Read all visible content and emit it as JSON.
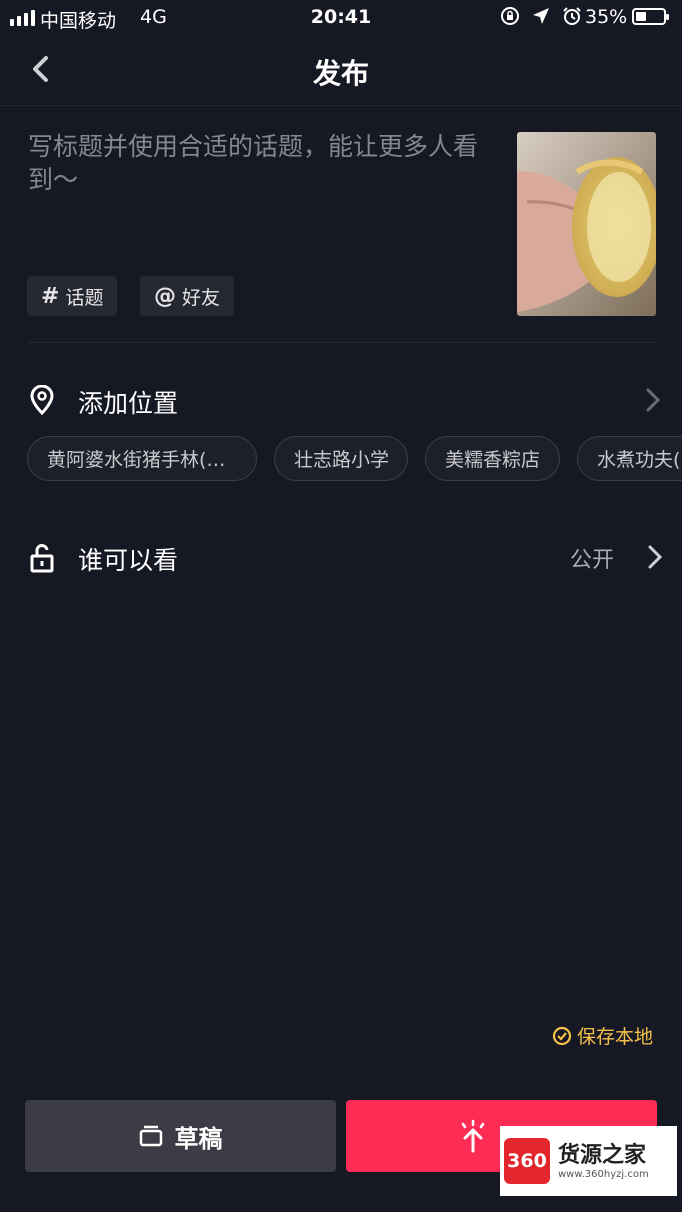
{
  "status_bar": {
    "carrier": "中国移动",
    "network": "4G",
    "time": "20:41",
    "battery": "35%"
  },
  "nav": {
    "title": "发布"
  },
  "caption": {
    "placeholder": "写标题并使用合适的话题，能让更多人看到～"
  },
  "chips": {
    "topic": {
      "symbol": "#",
      "label": "话题"
    },
    "friend": {
      "symbol": "@",
      "label": "好友"
    }
  },
  "location": {
    "label": "添加位置",
    "suggestions": [
      "黄阿婆水街猪手林(…",
      "壮志路小学",
      "美糯香粽店",
      "水煮功夫("
    ]
  },
  "privacy": {
    "label": "谁可以看",
    "value": "公开"
  },
  "save_local": {
    "label": "保存本地"
  },
  "buttons": {
    "draft": "草稿"
  },
  "watermark": {
    "logo": "360",
    "name": "货源之家",
    "url": "www.360hyzj.com"
  },
  "colors": {
    "background": "#161823",
    "accent": "#fe2c55",
    "save_local": "#f5c04a"
  },
  "icons": {
    "back": "chevron-left-icon",
    "location": "location-pin-icon",
    "privacy": "unlock-icon",
    "draft": "draft-box-icon",
    "publish": "upload-arrow-icon",
    "save_local": "check-circle-icon"
  }
}
